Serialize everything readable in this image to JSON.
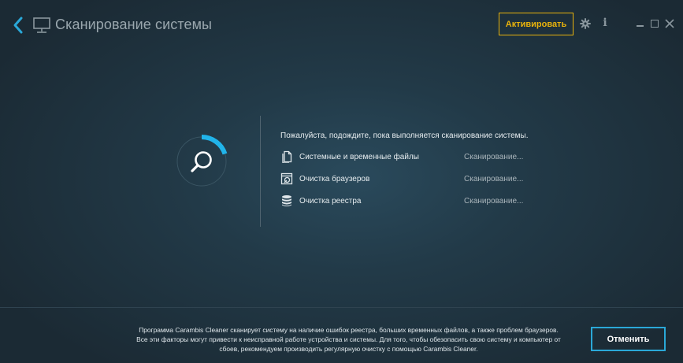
{
  "header": {
    "title": "Сканирование системы",
    "activate_label": "Активировать",
    "info_label": "i"
  },
  "scan": {
    "message": "Пожалуйста, подождите, пока выполняется сканирование системы.",
    "progress": 0.2,
    "items": [
      {
        "label": "Системные и временные файлы",
        "status": "Сканирование...",
        "icon": "file-icon"
      },
      {
        "label": "Очистка браузеров",
        "status": "Сканирование...",
        "icon": "browser-icon"
      },
      {
        "label": "Очистка реестра",
        "status": "Сканирование...",
        "icon": "database-icon"
      }
    ]
  },
  "footer": {
    "description": "Программа Carambis Cleaner сканирует систему на наличие ошибок реестра, больших временных файлов, а также проблем браузеров. Все эти факторы могут привести к неисправной работе устройства и системы. Для того, чтобы обезопасить свою систему и компьютер от сбоев, рекомендуем производить регулярную очистку с помощью Carambis Cleaner.",
    "cancel_label": "Отменить"
  },
  "colors": {
    "accent": "#2aa8d8",
    "activate": "#e8b20c",
    "background": "#223a48"
  }
}
